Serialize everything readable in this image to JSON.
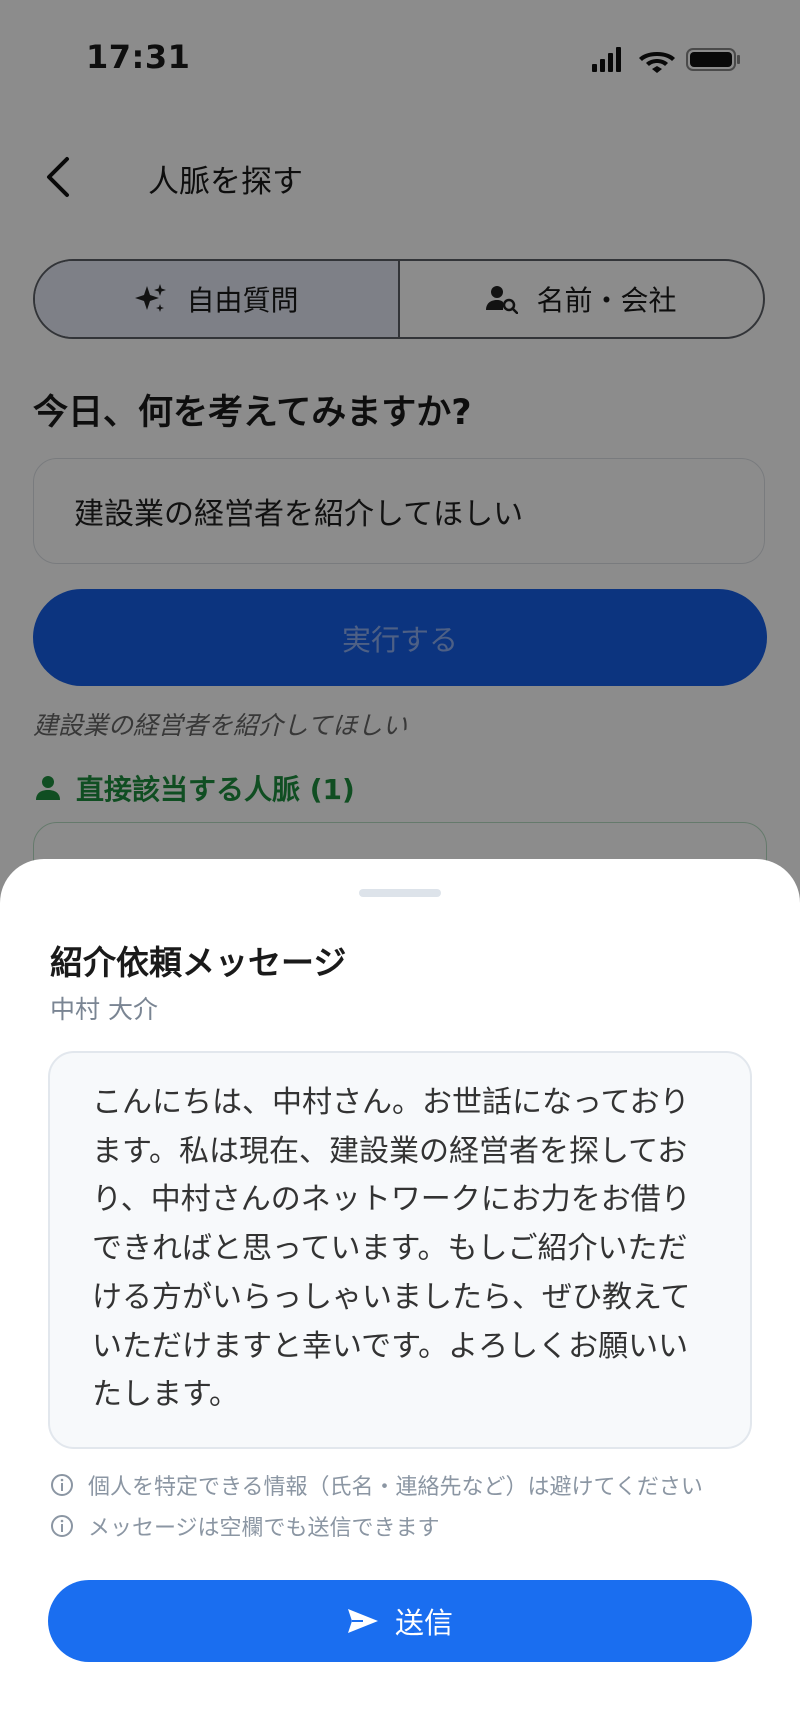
{
  "status_bar": {
    "time": "17:31"
  },
  "nav": {
    "back_icon": "chevron-left-icon",
    "title": "人脈を探す"
  },
  "tabs": [
    {
      "label": "自由質問",
      "icon": "sparkles-icon",
      "active": true
    },
    {
      "label": "名前・会社",
      "icon": "person-search-icon",
      "active": false
    }
  ],
  "main": {
    "heading": "今日、何を考えてみますか?",
    "query_value": "建設業の経営者を紹介してほしい",
    "run_button": "実行する",
    "query_echo": "建設業の経営者を紹介してほしい",
    "direct_matches_label": "直接該当する人脈 (1)"
  },
  "sheet": {
    "title": "紹介依頼メッセージ",
    "recipient": "中村 大介",
    "message": "こんにちは、中村さん。お世話になっております。私は現在、建設業の経営者を探しており、中村さんのネットワークにお力をお借りできればと思っています。もしご紹介いただける方がいらっしゃいましたら、ぜひ教えていただけますと幸いです。よろしくお願いいたします。",
    "notes": [
      "個人を特定できる情報（氏名・連絡先など）は避けてください",
      "メッセージは空欄でも送信できます"
    ],
    "send_button": "送信"
  },
  "colors": {
    "primary": "#1a6ef0",
    "success": "#1e8e3e",
    "muted": "#8b96a3"
  }
}
